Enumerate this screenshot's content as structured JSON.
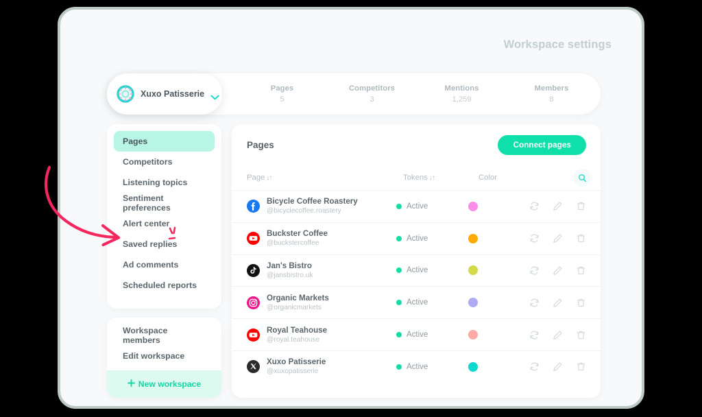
{
  "window": {
    "page_title": "Workspace settings",
    "background_color": "#000000",
    "panel_color": "#f7f9fa",
    "accent_color": "#0fdfa8"
  },
  "workspace": {
    "name": "Xuxo Patisserie",
    "logo_icon": "donut-logo-icon",
    "chevron_icon": "chevron-down-icon"
  },
  "stats": [
    {
      "label": "Pages",
      "value": "5"
    },
    {
      "label": "Competitors",
      "value": "3"
    },
    {
      "label": "Mentions",
      "value": "1,259"
    },
    {
      "label": "Members",
      "value": "8"
    }
  ],
  "sidebar": {
    "items": [
      {
        "label": "Pages",
        "active": true
      },
      {
        "label": "Competitors",
        "active": false
      },
      {
        "label": "Listening topics",
        "active": false
      },
      {
        "label": "Sentiment preferences",
        "active": false
      },
      {
        "label": "Alert center",
        "active": false
      },
      {
        "label": "Saved replies",
        "active": false
      },
      {
        "label": "Ad comments",
        "active": false
      },
      {
        "label": "Scheduled reports",
        "active": false
      }
    ],
    "footer_items": [
      {
        "label": "Workspace members"
      },
      {
        "label": "Edit workspace"
      }
    ],
    "new_workspace": {
      "label": "New workspace",
      "plus_icon": "plus-icon",
      "color": "#12d6a4",
      "background": "#ddfaf0"
    }
  },
  "main": {
    "title": "Pages",
    "connect_button": "Connect pages",
    "search_icon": "search-icon",
    "columns": {
      "page": "Page",
      "tokens": "Tokens",
      "color": "Color",
      "sort_icon": "sort-arrows-icon"
    },
    "row_actions": [
      {
        "name": "refresh-icon"
      },
      {
        "name": "edit-pencil-icon"
      },
      {
        "name": "delete-trash-icon"
      }
    ],
    "rows": [
      {
        "name": "Bicycle Coffee Roastery",
        "handle": "@bicyclecoffee.roastery",
        "network": "facebook",
        "token_status": "Active",
        "color": "#fc8cea"
      },
      {
        "name": "Buckster Coffee",
        "handle": "@buckstercoffee",
        "network": "youtube",
        "token_status": "Active",
        "color": "#ffab05"
      },
      {
        "name": "Jan's Bistro",
        "handle": "@jansbistro.uk",
        "network": "tiktok",
        "token_status": "Active",
        "color": "#d3d94b"
      },
      {
        "name": "Organic Markets",
        "handle": "@organicmarkets",
        "network": "instagram",
        "token_status": "Active",
        "color": "#afabf2"
      },
      {
        "name": "Royal Teahouse",
        "handle": "@royal.teahouse",
        "network": "youtube",
        "token_status": "Active",
        "color": "#fcaaa5"
      },
      {
        "name": "Xuxo Patisserie",
        "handle": "@xuxopatisserie",
        "network": "x",
        "token_status": "Active",
        "color": "#0ad9cb"
      }
    ]
  },
  "annotation": {
    "arrow_icon": "curved-arrow-annotation",
    "points_at": "Saved replies",
    "color": "#f5275f"
  }
}
